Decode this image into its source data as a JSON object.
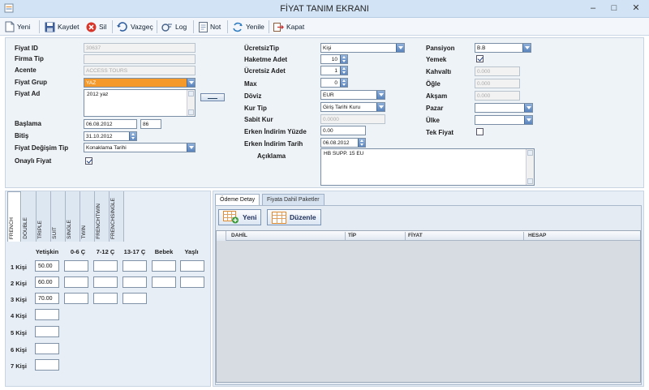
{
  "window": {
    "title": "FİYAT TANIM EKRANI"
  },
  "toolbar": {
    "new": "Yeni",
    "save": "Kaydet",
    "delete": "Sil",
    "cancel": "Vazgeç",
    "log": "Log",
    "note": "Not",
    "refresh": "Yenile",
    "close": "Kapat"
  },
  "form": {
    "left": {
      "fiyat_id": {
        "label": "Fiyat ID",
        "value": "30637"
      },
      "firma_tip": {
        "label": "Firma Tip",
        "value": ""
      },
      "acente": {
        "label": "Acente",
        "value": "ACCESS TOURS"
      },
      "fiyat_grup": {
        "label": "Fiyat Grup",
        "value": "YAZ"
      },
      "fiyat_ad": {
        "label": "Fiyat Ad",
        "value": "2012 yaz"
      },
      "baslama": {
        "label": "Başlama",
        "value": "06.08.2012",
        "days": "86"
      },
      "bitis": {
        "label": "Bitiş",
        "value": "31.10.2012"
      },
      "fiyat_degisim_tip": {
        "label": "Fiyat Değişim Tip",
        "value": "Konaklama Tarihi"
      },
      "onayli_fiyat": {
        "label": "Onaylı Fiyat",
        "checked": true
      }
    },
    "mid": {
      "ucretsiz_tip": {
        "label": "ÜcretsizTip",
        "value": "Kişi"
      },
      "haketme_adet": {
        "label": "Haketme Adet",
        "value": "10"
      },
      "ucretsiz_adet": {
        "label": "Ücretsiz Adet",
        "value": "1"
      },
      "max": {
        "label": "Max",
        "value": "0"
      },
      "doviz": {
        "label": "Döviz",
        "value": "EUR"
      },
      "kur_tip": {
        "label": "Kur Tip",
        "value": "Giriş Tarihi Kuru"
      },
      "sabit_kur": {
        "label": "Sabit Kur",
        "value": "0.0000"
      },
      "erken_indirim_yuzde": {
        "label": "Erken İndirim Yüzde",
        "value": "0.00"
      },
      "erken_indirim_tarih": {
        "label": "Erken İndirim Tarih",
        "value": "06.08.2012"
      },
      "aciklama": {
        "label": "Açıklama",
        "value": "HB SUPP. 15 EU"
      }
    },
    "right": {
      "pansiyon": {
        "label": "Pansiyon",
        "value": "B.B"
      },
      "yemek": {
        "label": "Yemek",
        "checked": true
      },
      "kahvalti": {
        "label": "Kahvaltı",
        "value": "0.000"
      },
      "ogle": {
        "label": "Öğle",
        "value": "0.000"
      },
      "aksam": {
        "label": "Akşam",
        "value": "0.000"
      },
      "pazar": {
        "label": "Pazar",
        "value": ""
      },
      "ulke": {
        "label": "Ülke",
        "value": ""
      },
      "tek_fiyat": {
        "label": "Tek Fiyat",
        "checked": false
      }
    }
  },
  "room_tabs": [
    "FRENCH",
    "DOUBLE",
    "TRIPLE",
    "SUIT",
    "SINGLE",
    "TWIN",
    "FRENCHTWIN",
    "FRENCHSINGLE"
  ],
  "price_grid": {
    "columns": [
      "Yetişkin",
      "0-6 Ç",
      "7-12 Ç",
      "13-17 Ç",
      "Bebek",
      "Yaşlı"
    ],
    "rows": [
      {
        "label": "1 Kişi",
        "cells": [
          "50.00",
          "",
          "",
          "",
          "",
          ""
        ]
      },
      {
        "label": "2 Kişi",
        "cells": [
          "60.00",
          "",
          "",
          "",
          "",
          ""
        ]
      },
      {
        "label": "3 Kişi",
        "cells": [
          "70.00",
          "",
          "",
          ""
        ]
      },
      {
        "label": "4 Kişi",
        "cells": [
          ""
        ]
      },
      {
        "label": "5 Kişi",
        "cells": [
          ""
        ]
      },
      {
        "label": "6 Kişi",
        "cells": [
          ""
        ]
      },
      {
        "label": "7 Kişi",
        "cells": [
          ""
        ]
      }
    ]
  },
  "payment_panel": {
    "tabs": [
      "Ödeme Detay",
      "Fiyata Dahil Paketler"
    ],
    "new_button": "Yeni",
    "edit_button": "Düzenle",
    "columns": [
      "DAHİL",
      "TİP",
      "FİYAT",
      "HESAP"
    ]
  }
}
